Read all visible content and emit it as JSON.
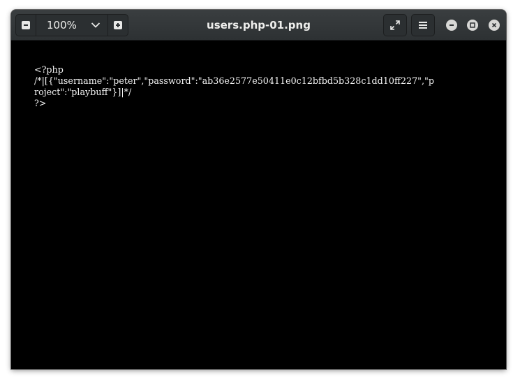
{
  "titlebar": {
    "title": "users.php-01.png",
    "zoom_level": "100%"
  },
  "icons": {
    "zoom_out": "minus-icon",
    "zoom_dropdown": "chevron-down-icon",
    "zoom_in": "plus-icon",
    "fullscreen": "expand-icon",
    "menu": "hamburger-menu-icon",
    "minimize": "minimize-icon",
    "maximize": "maximize-icon",
    "close": "close-icon"
  },
  "image_text": {
    "line1": "<?php",
    "line2": "/*|[{\"username\":\"peter\",\"password\":\"ab36e2577e50411e0c12bfbd5b328c1dd10ff227\",\"p",
    "line3": "roject\":\"playbuff\"}]|*/",
    "line4": "?>"
  }
}
